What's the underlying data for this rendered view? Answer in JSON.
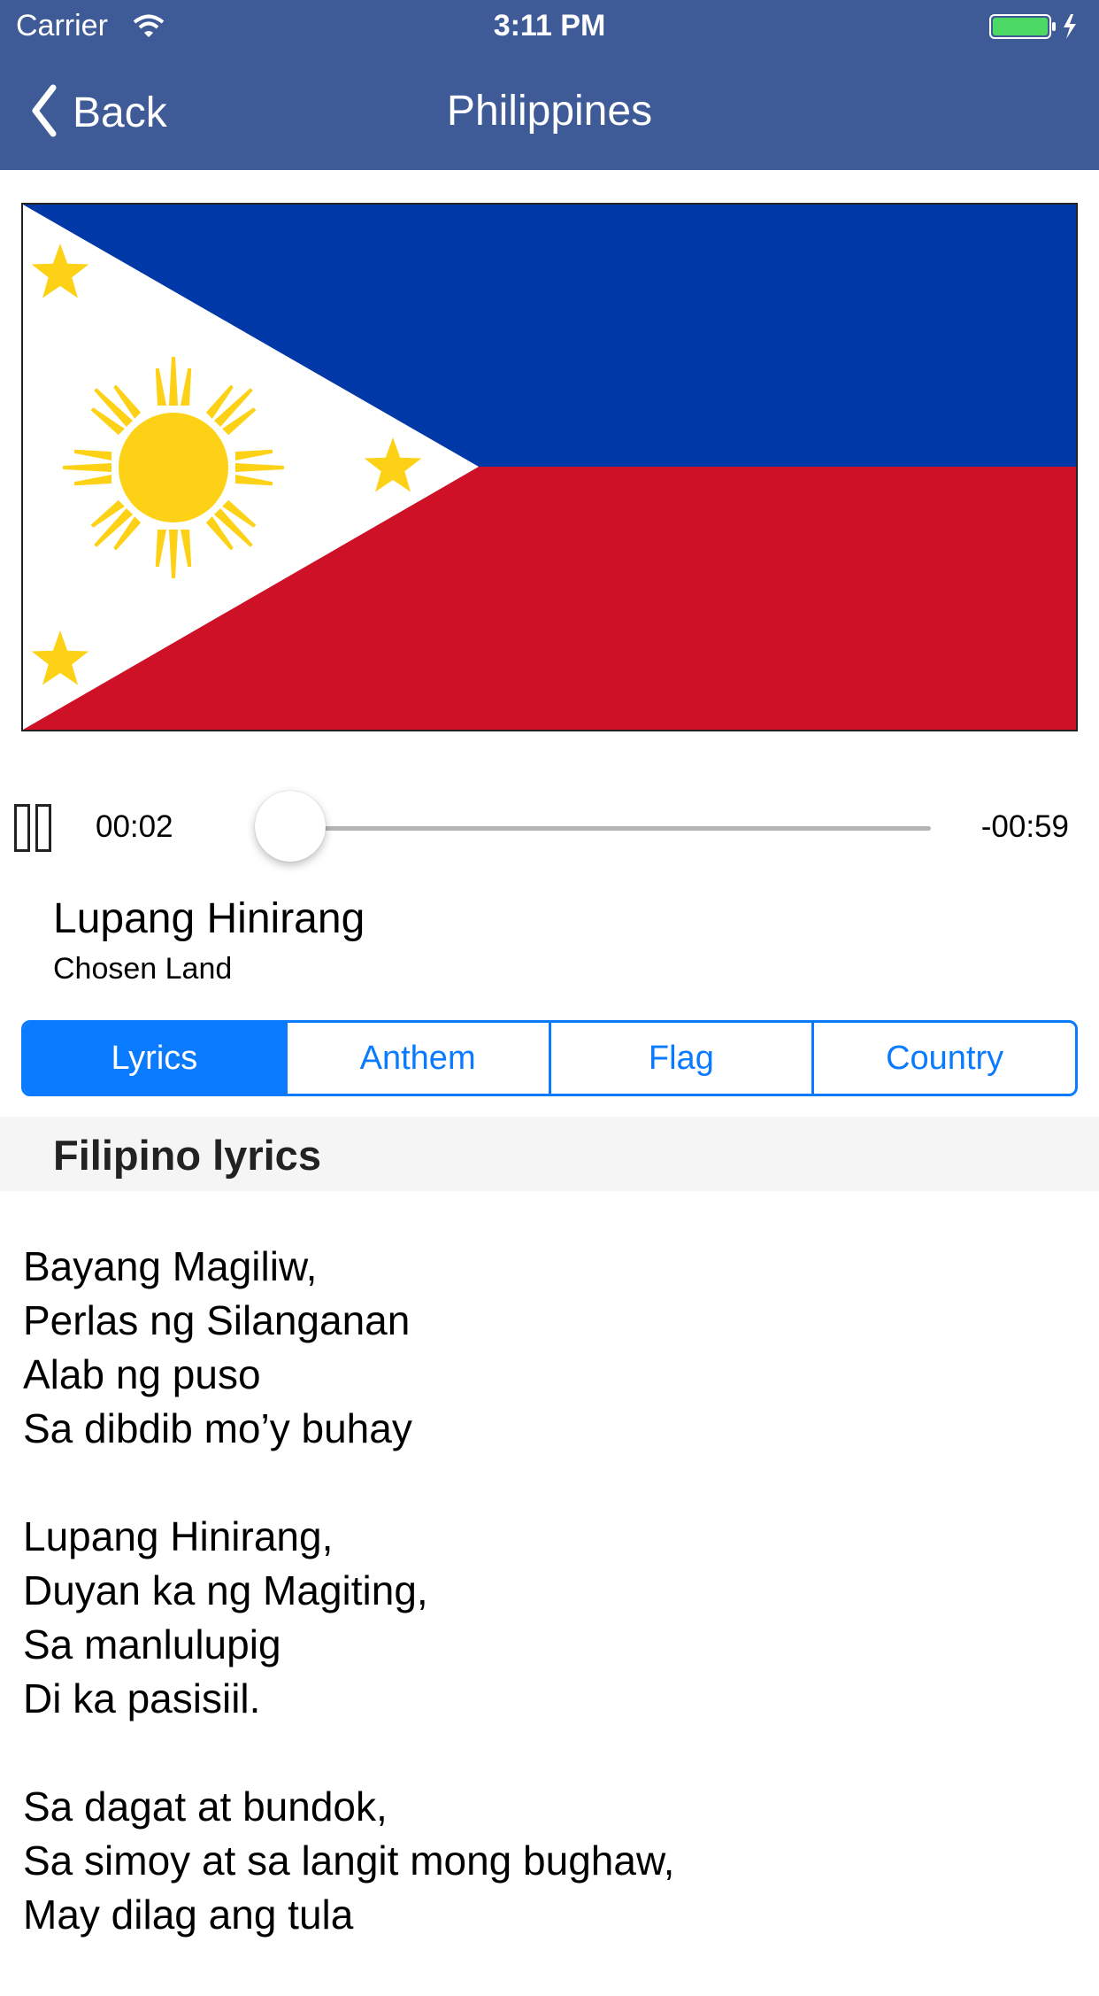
{
  "status_bar": {
    "carrier": "Carrier",
    "time": "3:11 PM",
    "battery_color": "#4cd964"
  },
  "navbar": {
    "back_label": "Back",
    "title": "Philippines",
    "background": "#3e5a97"
  },
  "flag": {
    "country": "Philippines",
    "colors": {
      "blue": "#0038a8",
      "red": "#ce1126",
      "white": "#ffffff",
      "gold": "#fcd116"
    }
  },
  "player": {
    "state": "playing",
    "elapsed": "00:02",
    "remaining": "-00:59",
    "progress": 0.03
  },
  "song": {
    "title": "Lupang Hinirang",
    "subtitle": "Chosen Land"
  },
  "tabs": [
    {
      "label": "Lyrics",
      "active": true
    },
    {
      "label": "Anthem",
      "active": false
    },
    {
      "label": "Flag",
      "active": false
    },
    {
      "label": "Country",
      "active": false
    }
  ],
  "lyrics": {
    "section_title": "Filipino lyrics",
    "stanzas": [
      [
        "Bayang Magiliw,",
        "Perlas ng Silanganan",
        "Alab ng puso",
        "Sa dibdib mo’y buhay"
      ],
      [
        "Lupang Hinirang,",
        "Duyan ka ng Magiting,",
        "Sa manlulupig",
        "Di ka pasisiil."
      ],
      [
        "Sa dagat at bundok,",
        "Sa simoy at sa langit mong bughaw,",
        "May dilag ang tula"
      ]
    ]
  }
}
